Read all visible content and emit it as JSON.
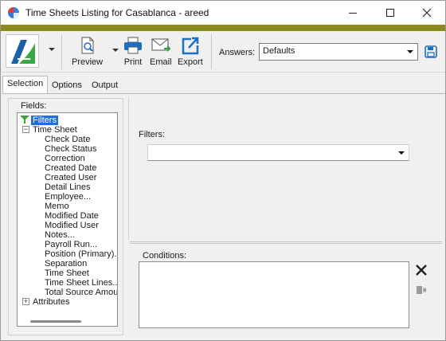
{
  "window": {
    "title": "Time Sheets Listing for Casablanca - areed",
    "accent_color": "#8b8a1e"
  },
  "toolbar": {
    "preview_label": "Preview",
    "print_label": "Print",
    "email_label": "Email",
    "export_label": "Export",
    "answers_label": "Answers:",
    "answers_value": "Defaults"
  },
  "tabs": [
    {
      "label": "Selection",
      "active": true
    },
    {
      "label": "Options",
      "active": false
    },
    {
      "label": "Output",
      "active": false
    }
  ],
  "fields": {
    "label": "Fields:",
    "tree": {
      "filters": "Filters",
      "time_sheet": "Time Sheet",
      "items": [
        "Check Date",
        "Check Status",
        "Correction",
        "Created Date",
        "Created User",
        "Detail Lines",
        "Employee...",
        "Memo",
        "Modified Date",
        "Modified User",
        "Notes...",
        "Payroll Run...",
        "Position (Primary)...",
        "Separation",
        "Time Sheet",
        "Time Sheet Lines...",
        "Total Source Amou"
      ],
      "attributes": "Attributes"
    }
  },
  "filters": {
    "label": "Filters:",
    "value": ""
  },
  "conditions": {
    "label": "Conditions:"
  }
}
